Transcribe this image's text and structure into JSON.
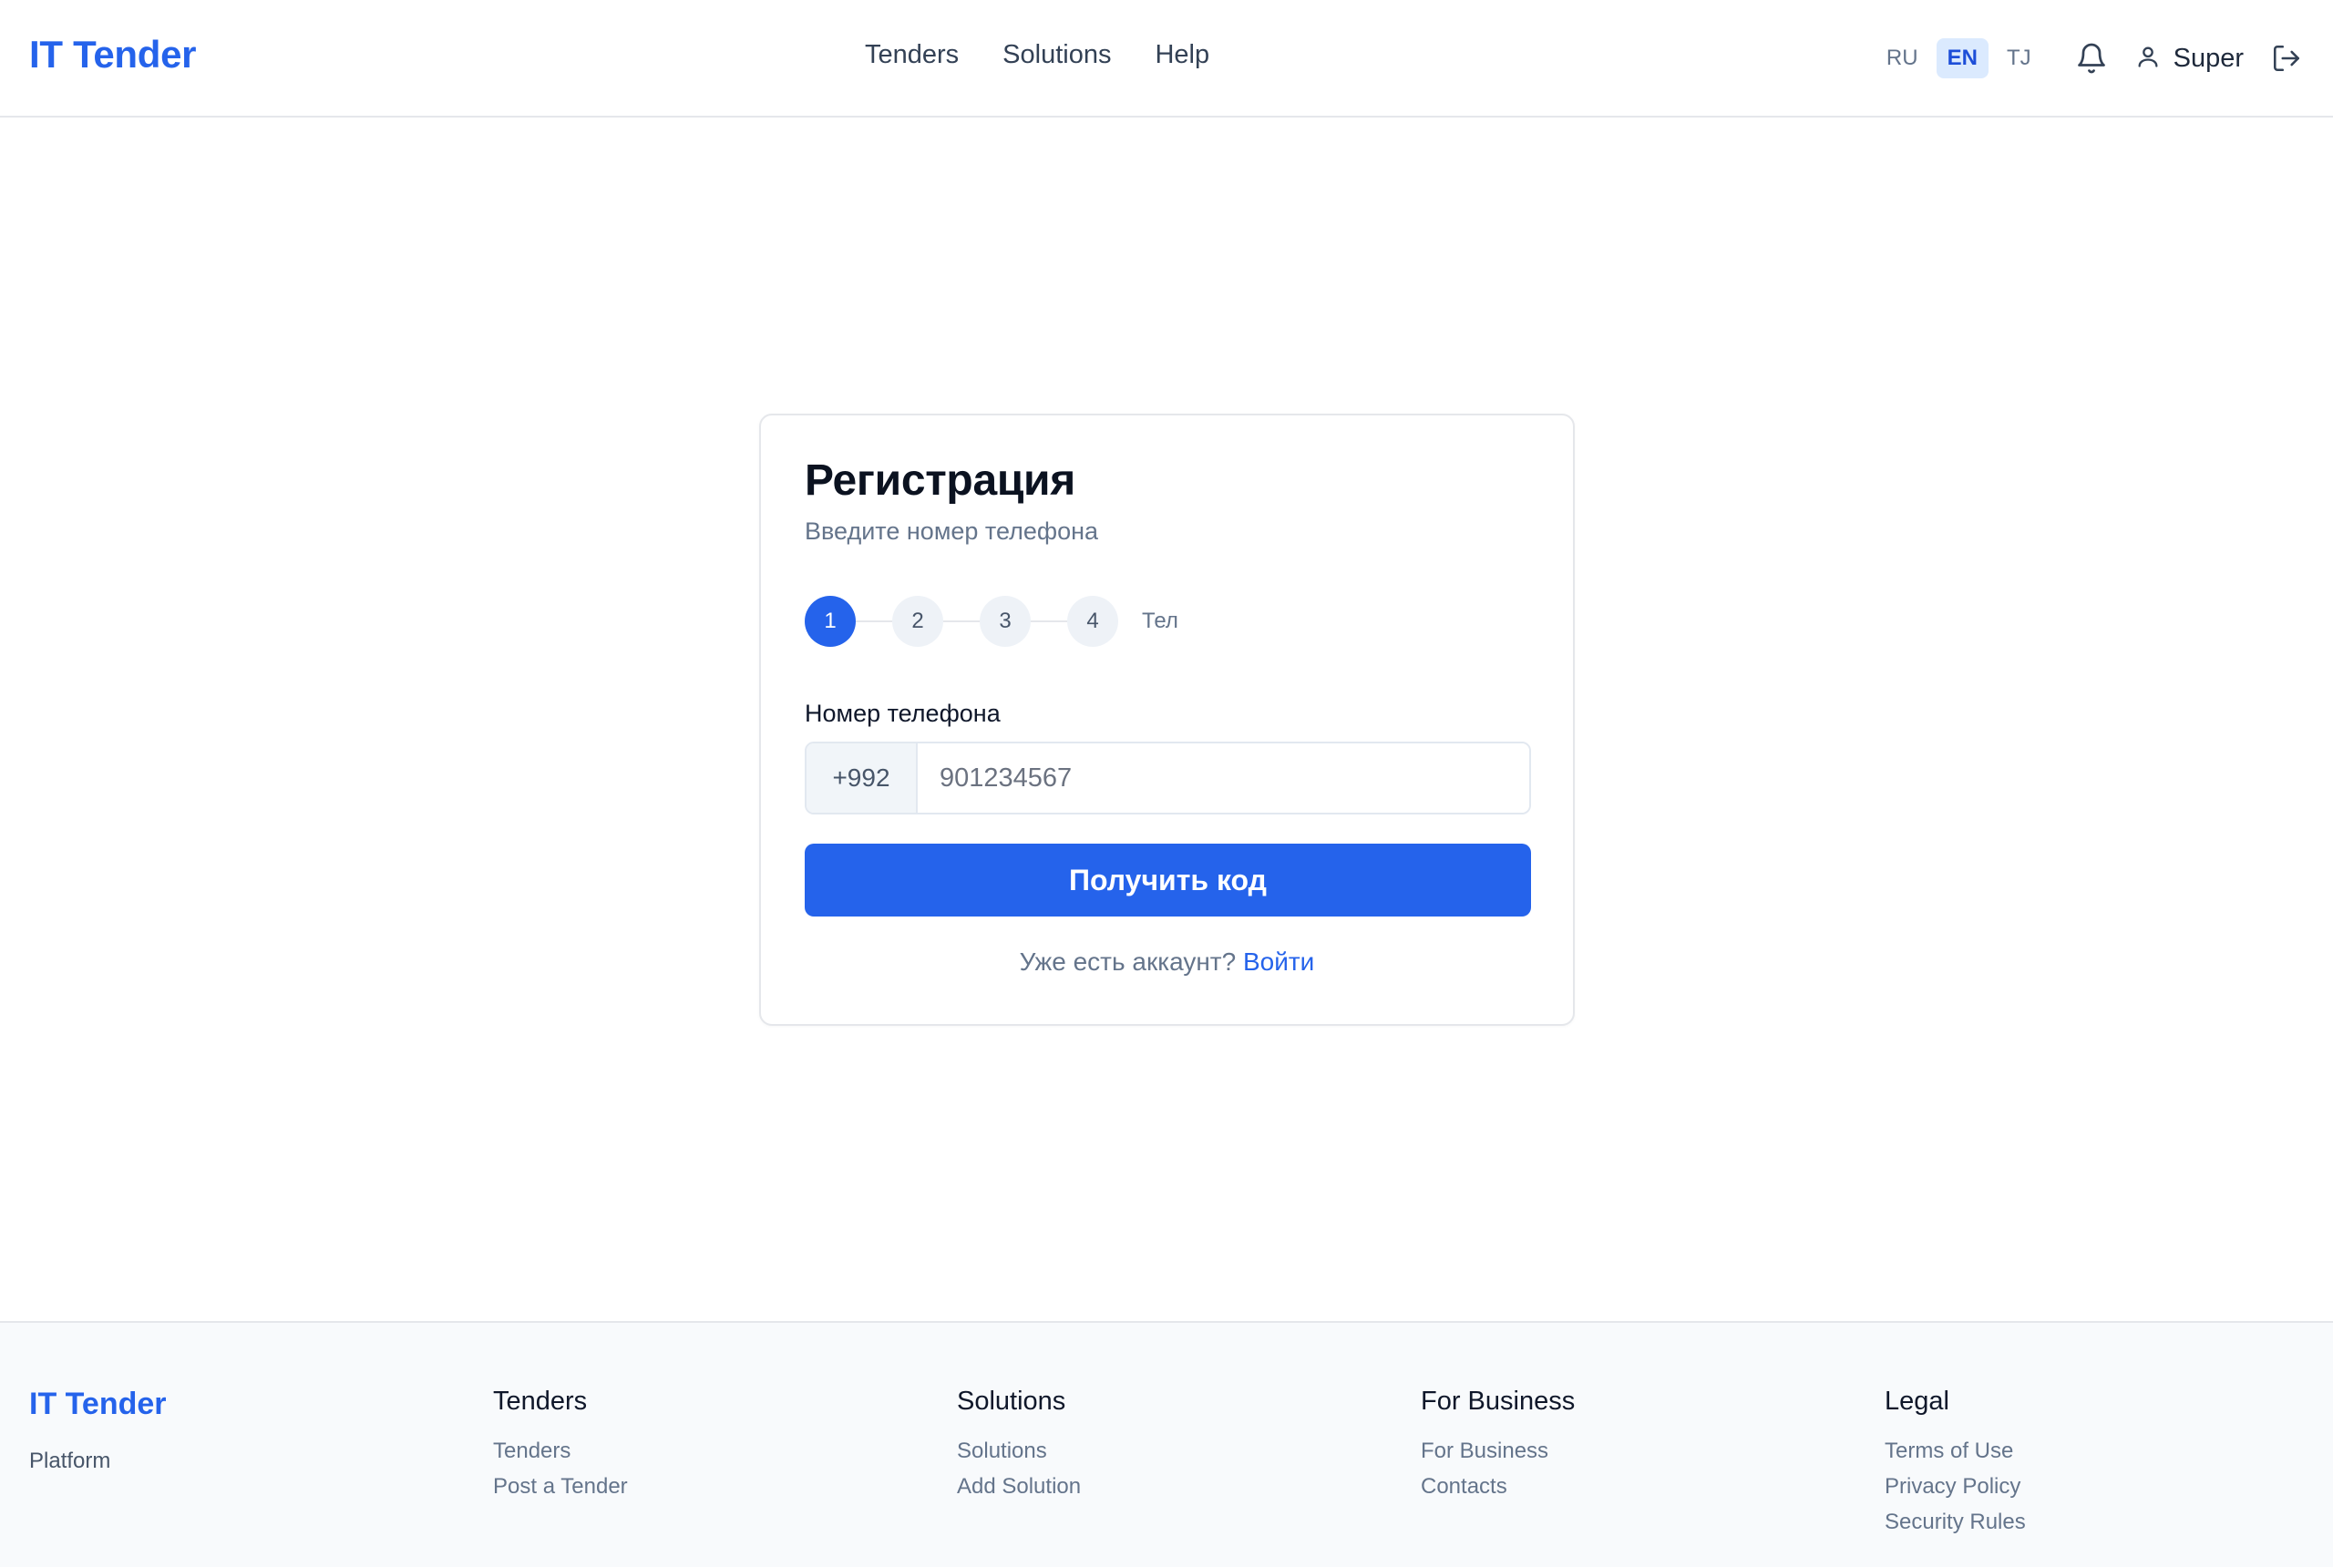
{
  "header": {
    "brand": "IT Tender",
    "nav": [
      "Tenders",
      "Solutions",
      "Help"
    ],
    "languages": [
      "RU",
      "EN",
      "TJ"
    ],
    "active_language": "EN",
    "user_name": "Super",
    "icons": {
      "bell": "bell-icon",
      "user": "user-icon",
      "logout": "logout-icon"
    }
  },
  "card": {
    "title": "Регистрация",
    "subtitle": "Введите номер телефона",
    "steps": [
      "1",
      "2",
      "3",
      "4"
    ],
    "active_step": "1",
    "step_label": "Тел",
    "field_label": "Номер телефона",
    "phone_prefix": "+992",
    "phone_placeholder": "901234567",
    "phone_value": "",
    "submit_label": "Получить код",
    "login_prompt": "Уже есть аккаунт?",
    "login_link": "Войти"
  },
  "footer": {
    "brand": "IT Tender",
    "tagline": "Platform",
    "columns": [
      {
        "title": "Tenders",
        "links": [
          "Tenders",
          "Post a Tender"
        ]
      },
      {
        "title": "Solutions",
        "links": [
          "Solutions",
          "Add Solution"
        ]
      },
      {
        "title": "For Business",
        "links": [
          "For Business",
          "Contacts"
        ]
      },
      {
        "title": "Legal",
        "links": [
          "Terms of Use",
          "Privacy Policy",
          "Security Rules"
        ]
      }
    ]
  },
  "colors": {
    "accent": "#2563eb",
    "active_lang_bg": "#dbeafe",
    "muted_text": "#64748b"
  }
}
